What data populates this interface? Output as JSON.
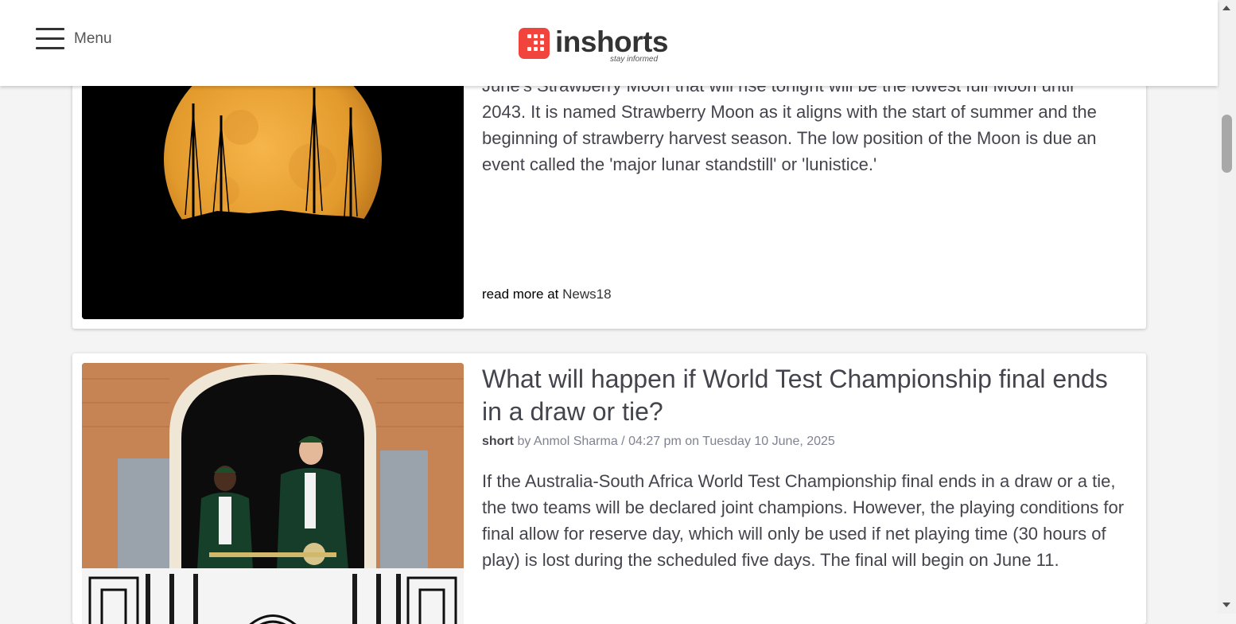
{
  "header": {
    "menu_label": "Menu",
    "logo_text": "inshorts",
    "logo_tagline": "stay informed",
    "brand_color": "#f0443c"
  },
  "articles": [
    {
      "headline_partial": "",
      "body_cutoff_line": "June's Strawberry Moon that will rise tonight will be the lowest full Moon until",
      "body": "2043. It is named Strawberry Moon as it aligns with the start of summer and the beginning of strawberry harvest season. The low position of the Moon is due an event called the 'major lunar standstill' or 'lunistice.'",
      "read_more_prefix": "read more at",
      "source": "News18"
    },
    {
      "headline": "What will happen if World Test Championship final ends in a draw or tie?",
      "meta_short": "short",
      "meta_by": "by Anmol Sharma / 04:27 pm on Tuesday 10 June, 2025",
      "body": "If the Australia-South Africa World Test Championship final ends in a draw or a tie, the two teams will be declared joint champions. However, the playing conditions for final allow for reserve day, which will only be used if net playing time (30 hours of play) is lost during the scheduled five days. The final will begin on June 11."
    }
  ],
  "icons": {
    "menu": "hamburger-icon",
    "logo": "inshorts-logo-icon"
  }
}
